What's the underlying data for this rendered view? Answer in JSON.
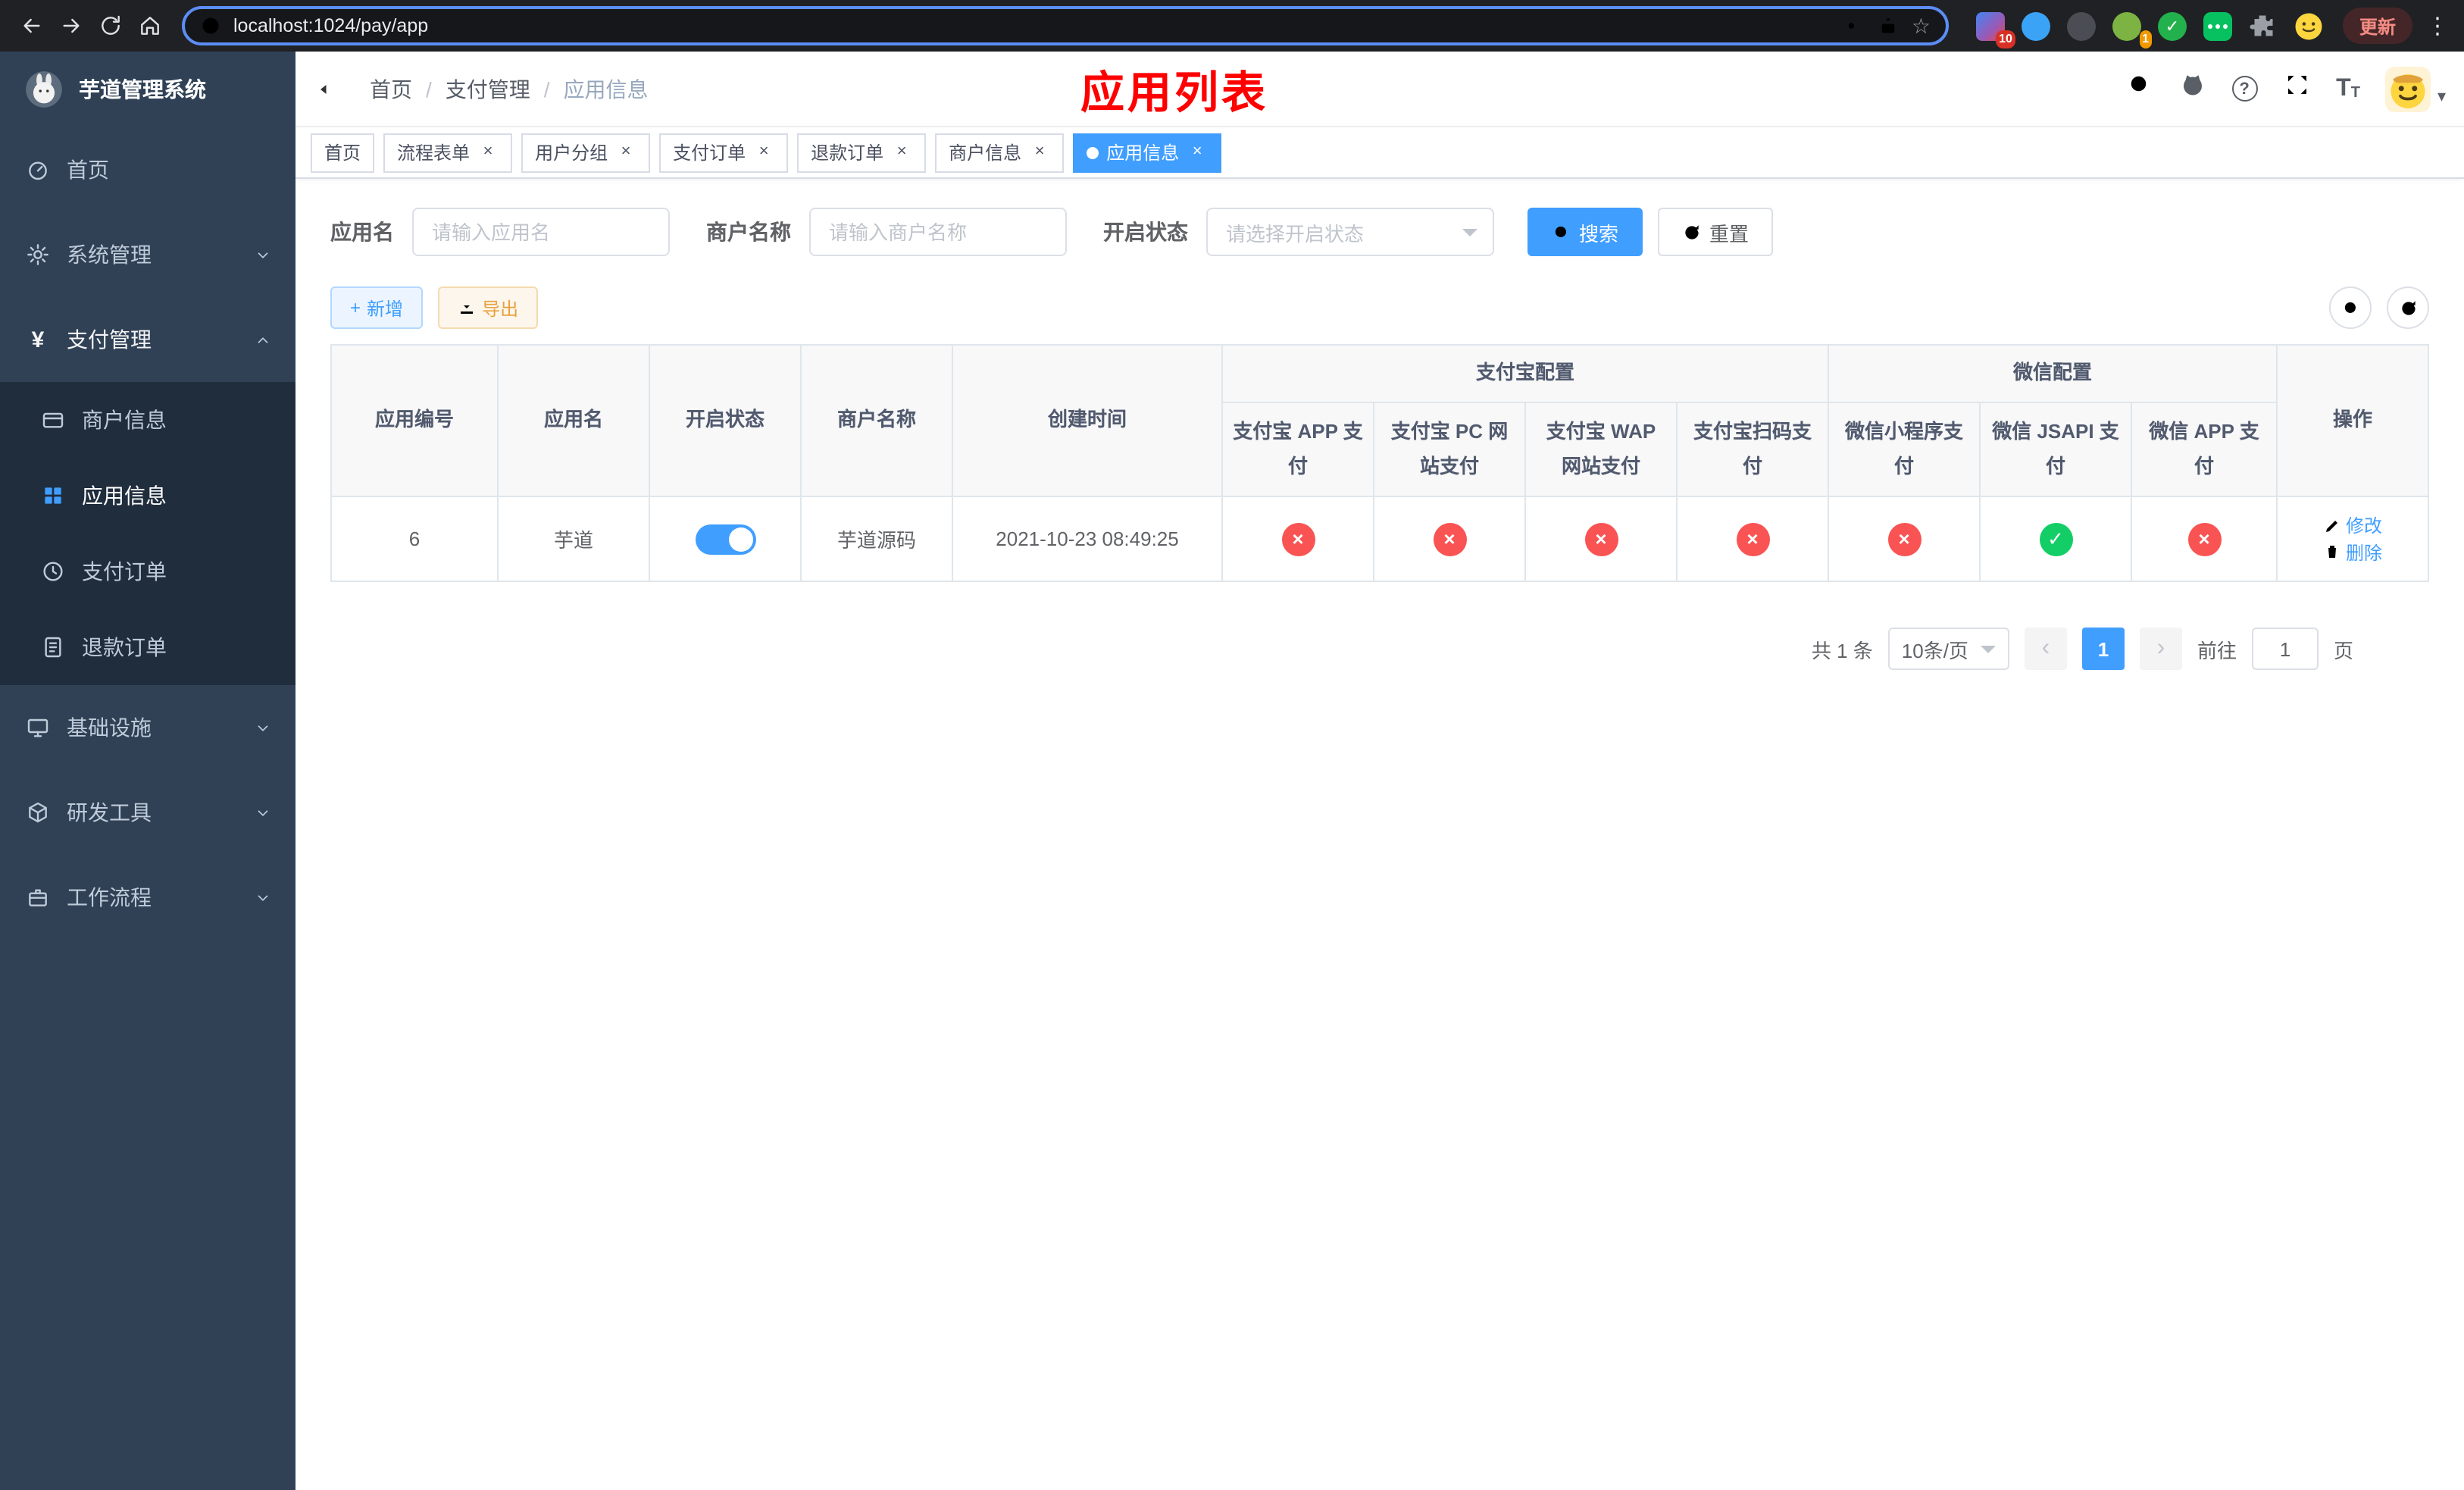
{
  "browser": {
    "url": "localhost:1024/pay/app",
    "update_label": "更新",
    "ext_badge_10": "10",
    "ext_badge_1": "1"
  },
  "icons": {
    "close": "×",
    "cross": "×",
    "check": "✓",
    "question": "?",
    "star": "☆",
    "dots": "⋮",
    "info": "i",
    "yen": "¥",
    "plus": "+",
    "caret_down": "▾",
    "prev": "‹",
    "next": "›",
    "tsize": "T"
  },
  "colors": {
    "accent": "#409EFF",
    "success_green": "#13ce66",
    "danger_red": "#f95353",
    "title_red": "#ff0000",
    "sidebar_bg": "#304156"
  },
  "sidebar": {
    "title": "芋道管理系统",
    "items": {
      "home": "首页",
      "system": "系统管理",
      "payment": "支付管理",
      "merchant": "商户信息",
      "app": "应用信息",
      "pay_order": "支付订单",
      "refund_order": "退款订单",
      "infra": "基础设施",
      "devtools": "研发工具",
      "workflow": "工作流程"
    }
  },
  "breadcrumb": {
    "home": "首页",
    "section": "支付管理",
    "current": "应用信息"
  },
  "page_title": "应用列表",
  "tabs": [
    {
      "label": "首页"
    },
    {
      "label": "流程表单"
    },
    {
      "label": "用户分组"
    },
    {
      "label": "支付订单"
    },
    {
      "label": "退款订单"
    },
    {
      "label": "商户信息"
    },
    {
      "label": "应用信息"
    }
  ],
  "filters": {
    "app_name_label": "应用名",
    "app_name_placeholder": "请输入应用名",
    "merchant_label": "商户名称",
    "merchant_placeholder": "请输入商户名称",
    "status_label": "开启状态",
    "status_placeholder": "请选择开启状态",
    "search_label": "搜索",
    "reset_label": "重置"
  },
  "toolbar": {
    "add_label": "新增",
    "export_label": "导出"
  },
  "table": {
    "headers": {
      "app_id": "应用编号",
      "app_name": "应用名",
      "status": "开启状态",
      "merchant": "商户名称",
      "created": "创建时间",
      "alipay_group": "支付宝配置",
      "wechat_group": "微信配置",
      "alipay_app": "支付宝 APP 支付",
      "alipay_pc": "支付宝 PC 网站支付",
      "alipay_wap": "支付宝 WAP 网站支付",
      "alipay_qr": "支付宝扫码支付",
      "wx_lite": "微信小程序支付",
      "wx_jsapi": "微信 JSAPI 支付",
      "wx_app": "微信 APP 支付",
      "actions": "操作"
    },
    "row": {
      "id": "6",
      "name": "芋道",
      "enabled": true,
      "merchant": "芋道源码",
      "created": "2021-10-23 08:49:25",
      "alipay_app": false,
      "alipay_pc": false,
      "alipay_wap": false,
      "alipay_qr": false,
      "wx_lite": false,
      "wx_jsapi": true,
      "wx_app": false,
      "edit_label": "修改",
      "delete_label": "删除"
    }
  },
  "pagination": {
    "total": "共 1 条",
    "page_size": "10条/页",
    "page": "1",
    "goto_label": "前往",
    "goto_value": "1",
    "unit_label": "页"
  }
}
